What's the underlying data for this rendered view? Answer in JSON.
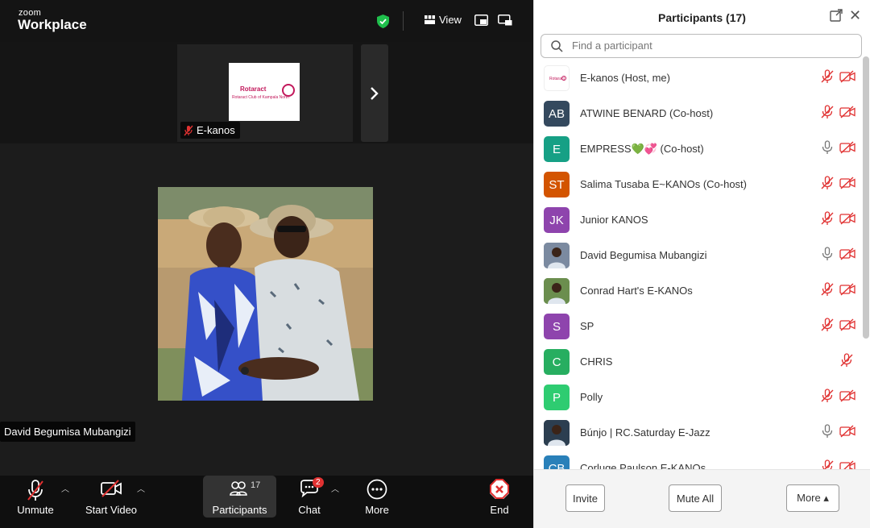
{
  "app": {
    "logo_small": "zoom",
    "logo_big": "Workplace"
  },
  "topbar": {
    "view_label": "View"
  },
  "gallery": {
    "thumb_name": "E-kanos",
    "thumb_logo_text": "Rotaract",
    "thumb_logo_sub": "Rotaract Club of Kampala North"
  },
  "main": {
    "speaker_name": "David Begumisa Mubangizi"
  },
  "toolbar": {
    "unmute": "Unmute",
    "start_video": "Start Video",
    "participants": "Participants",
    "participants_count": "17",
    "chat": "Chat",
    "chat_badge": "2",
    "more": "More",
    "end": "End"
  },
  "panel": {
    "title": "Participants (17)",
    "search_placeholder": "Find a participant",
    "invite": "Invite",
    "mute_all": "Mute All",
    "more": "More ▴"
  },
  "participants": [
    {
      "initials": "",
      "name": "E-kanos (Host, me)",
      "color": "#ffffff",
      "mic": "muted",
      "cam": "off"
    },
    {
      "initials": "AB",
      "name": "ATWINE BENARD (Co-host)",
      "color": "#34495e",
      "mic": "muted",
      "cam": "off"
    },
    {
      "initials": "E",
      "name": "EMPRESS💚💞 (Co-host)",
      "color": "#16a085",
      "mic": "on",
      "cam": "off"
    },
    {
      "initials": "ST",
      "name": "Salima Tusaba E~KANOs (Co-host)",
      "color": "#d35400",
      "mic": "muted",
      "cam": "off"
    },
    {
      "initials": "JK",
      "name": "Junior KANOS",
      "color": "#8e44ad",
      "mic": "muted",
      "cam": "off"
    },
    {
      "initials": "",
      "name": "David Begumisa Mubangizi",
      "color": "#7b8aa0",
      "mic": "on",
      "cam": "off"
    },
    {
      "initials": "",
      "name": "Conrad Hart's E-KANOs",
      "color": "#6b8e4e",
      "mic": "muted",
      "cam": "off"
    },
    {
      "initials": "S",
      "name": "SP",
      "color": "#8e44ad",
      "mic": "muted",
      "cam": "off"
    },
    {
      "initials": "C",
      "name": "CHRIS",
      "color": "#27ae60",
      "mic": "muted",
      "cam": "none"
    },
    {
      "initials": "P",
      "name": "Polly",
      "color": "#2ecc71",
      "mic": "muted",
      "cam": "off"
    },
    {
      "initials": "",
      "name": "Búnjo | RC.Saturday E-Jazz",
      "color": "#2c3e50",
      "mic": "on",
      "cam": "off"
    },
    {
      "initials": "CB",
      "name": "Corluge Paulson E-KANOs",
      "color": "#2980b9",
      "mic": "muted",
      "cam": "off"
    }
  ]
}
